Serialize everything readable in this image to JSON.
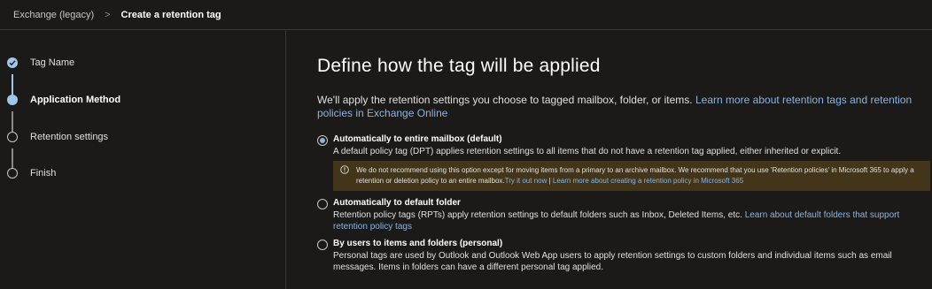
{
  "breadcrumb": {
    "parent": "Exchange (legacy)",
    "separator": ">",
    "current": "Create a retention tag"
  },
  "steps": [
    {
      "label": "Tag Name",
      "state": "done"
    },
    {
      "label": "Application Method",
      "state": "current"
    },
    {
      "label": "Retention settings",
      "state": "pending"
    },
    {
      "label": "Finish",
      "state": "pending"
    }
  ],
  "main": {
    "title": "Define how the tag will be applied",
    "intro_text": "We'll apply the retention settings you choose to tagged mailbox, folder, or items. ",
    "intro_link": "Learn more about retention tags and retention policies in Exchange Online",
    "options": [
      {
        "title": "Automatically to entire mailbox (default)",
        "description": "A default policy tag (DPT) applies retention settings to all items that do not have a retention tag applied, either inherited or explicit.",
        "link": "",
        "selected": true
      },
      {
        "title": "Automatically to default folder",
        "description": "Retention policy tags (RPTs) apply retention settings to default folders such as Inbox, Deleted Items, etc. ",
        "link": "Learn about default folders that support retention policy tags",
        "selected": false
      },
      {
        "title": "By users to items and folders (personal)",
        "description": "Personal tags are used by Outlook and Outlook Web App users to apply retention settings to custom folders and individual items such as email messages. Items in folders can have a different personal tag applied.",
        "link": "",
        "selected": false
      }
    ],
    "warning": {
      "icon": "info-icon",
      "text": "We do not recommend using this option except for moving items from a primary to an archive mailbox. We recommend that you use 'Retention policies' in Microsoft 365 to apply a retention or deletion policy to an entire mailbox.",
      "link1": "Try it out now",
      "divider": " | ",
      "link2": "Learn more about creating a retention policy in Microsoft 365"
    }
  },
  "colors": {
    "background": "#1b1a19",
    "accent": "#9ec7ec",
    "link": "#8ab4e0",
    "warning_bg": "#433519"
  }
}
